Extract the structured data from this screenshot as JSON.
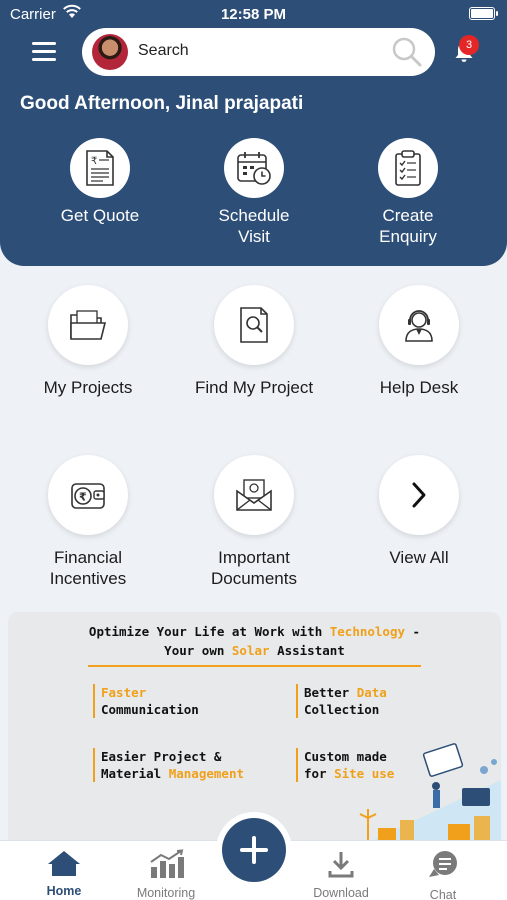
{
  "status": {
    "carrier": "Carrier",
    "time": "12:58 PM"
  },
  "search": {
    "placeholder": "Search"
  },
  "notifications": {
    "count": "3"
  },
  "greeting": "Good Afternoon, Jinal prajapati",
  "quick_actions": [
    {
      "label": "Get Quote",
      "icon": "quote-document-icon"
    },
    {
      "label": "Schedule Visit",
      "icon": "calendar-clock-icon"
    },
    {
      "label": "Create Enquiry",
      "icon": "clipboard-checklist-icon"
    }
  ],
  "tiles": [
    {
      "label": "My Projects",
      "icon": "folder-icon"
    },
    {
      "label": "Find My Project",
      "icon": "document-search-icon"
    },
    {
      "label": "Help Desk",
      "icon": "support-agent-icon"
    },
    {
      "label": "Financial Incentives",
      "icon": "rupee-wallet-icon"
    },
    {
      "label": "Important Documents",
      "icon": "envelope-document-icon"
    },
    {
      "label": "View All",
      "icon": "chevron-right-icon"
    }
  ],
  "banner": {
    "line1_a": "Optimize Your Life at Work with ",
    "line1_hl": "Technology",
    "line1_b": " -",
    "line2_a": "Your own ",
    "line2_hl": "Solar",
    "line2_b": " Assistant",
    "features": [
      {
        "hl": "Faster",
        "text": "Communication"
      },
      {
        "text": "Better ",
        "hl": "Data",
        "text2": "Collection"
      },
      {
        "text": "Easier Project &",
        "text2": "Material ",
        "hl": "Management"
      },
      {
        "text": "Custom made",
        "text2": "for ",
        "hl": "Site use"
      }
    ]
  },
  "bottom_nav": [
    {
      "label": "Home",
      "icon": "home-icon",
      "active": true
    },
    {
      "label": "Monitoring",
      "icon": "bar-chart-icon"
    },
    {
      "label": "Download",
      "icon": "download-icon"
    },
    {
      "label": "Chat",
      "icon": "chat-bubble-icon"
    }
  ],
  "colors": {
    "primary": "#2d4e77",
    "accent": "#f0a01a",
    "background": "#eef2f6",
    "badge": "#e52626"
  }
}
